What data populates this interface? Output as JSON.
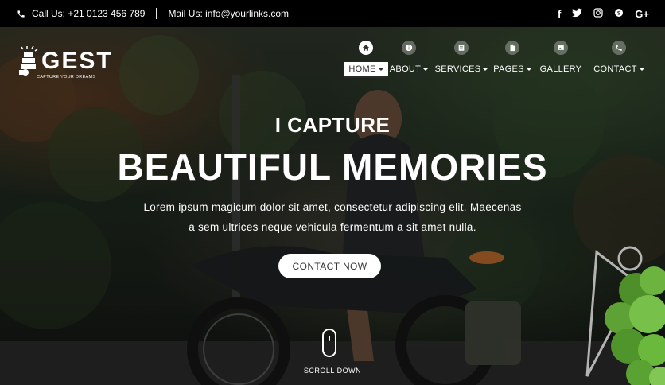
{
  "topbar": {
    "call_label": "Call Us: +21 0123 456 789",
    "mail_label": "Mail Us: info@yourlinks.com",
    "social": [
      {
        "name": "facebook",
        "glyph": "f"
      },
      {
        "name": "twitter",
        "glyph": "t"
      },
      {
        "name": "instagram",
        "glyph": "◎"
      },
      {
        "name": "skype",
        "glyph": "S"
      },
      {
        "name": "google-plus",
        "glyph": "G+"
      }
    ]
  },
  "logo": {
    "word": "GEST",
    "tagline": "CAPTURE YOUR DREAMS"
  },
  "nav": {
    "items": [
      {
        "label": "HOME",
        "icon": "home-icon",
        "dropdown": true,
        "active": true
      },
      {
        "label": "ABOUT",
        "icon": "info-icon",
        "dropdown": true,
        "active": false
      },
      {
        "label": "SERVICES",
        "icon": "list-icon",
        "dropdown": true,
        "active": false
      },
      {
        "label": "PAGES",
        "icon": "document-icon",
        "dropdown": true,
        "active": false
      },
      {
        "label": "GALLERY",
        "icon": "image-icon",
        "dropdown": false,
        "active": false
      },
      {
        "label": "CONTACT",
        "icon": "phone-icon",
        "dropdown": true,
        "active": false
      }
    ]
  },
  "hero": {
    "subtitle": "I CAPTURE",
    "title": "BEAUTIFUL MEMORIES",
    "lead_line1": "Lorem ipsum magicum dolor sit amet, consectetur adipiscing elit. Maecenas",
    "lead_line2": "a sem ultrices neque vehicula fermentum a sit amet nulla.",
    "cta_label": "CONTACT NOW",
    "scroll_label": "SCROLL DOWN"
  },
  "colors": {
    "topbar_bg": "#000000",
    "accent": "#ffffff",
    "hero_overlay": "#1f2a1f"
  }
}
